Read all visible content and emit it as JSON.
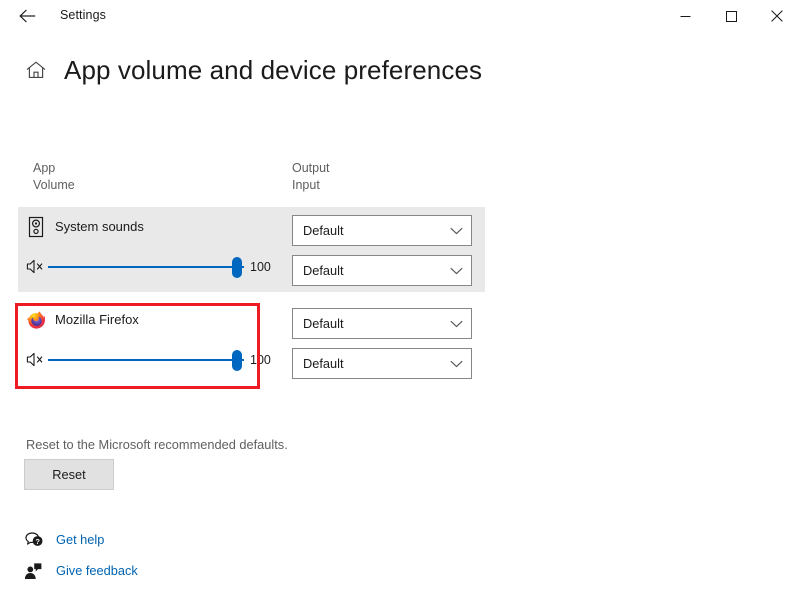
{
  "window": {
    "title": "Settings",
    "back_icon": "back-arrow-icon",
    "minimize_icon": "minimize-icon",
    "maximize_icon": "maximize-icon",
    "close_icon": "close-icon"
  },
  "header": {
    "home_icon": "home-icon",
    "title": "App volume and device preferences"
  },
  "columns": {
    "app": "App",
    "volume": "Volume",
    "output": "Output",
    "input": "Input"
  },
  "rows": [
    {
      "icon": "speaker-icon",
      "name": "System sounds",
      "mute_icon": "volume-mute-icon",
      "volume": "100",
      "volume_percent": 100,
      "output": "Default",
      "input": "Default",
      "highlighted": true,
      "annotated": false
    },
    {
      "icon": "firefox-icon",
      "name": "Mozilla Firefox",
      "mute_icon": "volume-mute-icon",
      "volume": "100",
      "volume_percent": 100,
      "output": "Default",
      "input": "Default",
      "highlighted": false,
      "annotated": true
    }
  ],
  "reset": {
    "note": "Reset to the Microsoft recommended defaults.",
    "button_label": "Reset"
  },
  "footer": {
    "links": [
      {
        "icon": "help-question-bubble-icon",
        "label": "Get help"
      },
      {
        "icon": "feedback-person-icon",
        "label": "Give feedback"
      }
    ]
  },
  "colors": {
    "accent": "#0067c0",
    "link": "#0063b1",
    "annotation": "#ee1b24",
    "row_highlight": "#e9e9e9"
  }
}
